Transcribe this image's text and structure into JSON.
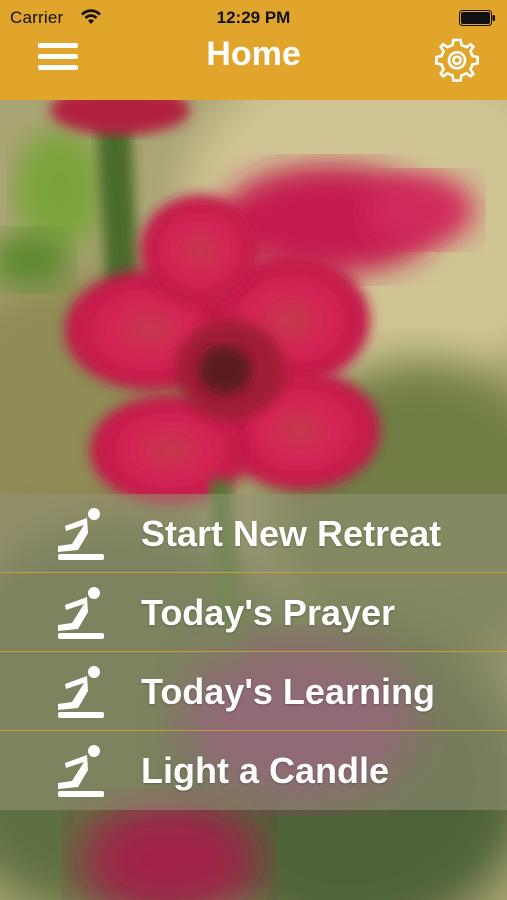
{
  "status_bar": {
    "carrier": "Carrier",
    "time": "12:29 PM"
  },
  "nav_bar": {
    "title": "Home",
    "left_icon": "hamburger-menu-icon",
    "right_icon": "gear-icon"
  },
  "colors": {
    "accent": "#e2a52c",
    "menu_text": "#ffffff",
    "menu_overlay": "rgba(150,145,120,0.55)"
  },
  "menu": {
    "items": [
      {
        "label": "Start New Retreat",
        "icon": "kneeling-prayer-icon"
      },
      {
        "label": "Today's Prayer",
        "icon": "kneeling-prayer-icon"
      },
      {
        "label": "Today's Learning",
        "icon": "kneeling-prayer-icon"
      },
      {
        "label": "Light a Candle",
        "icon": "kneeling-prayer-icon"
      }
    ]
  }
}
